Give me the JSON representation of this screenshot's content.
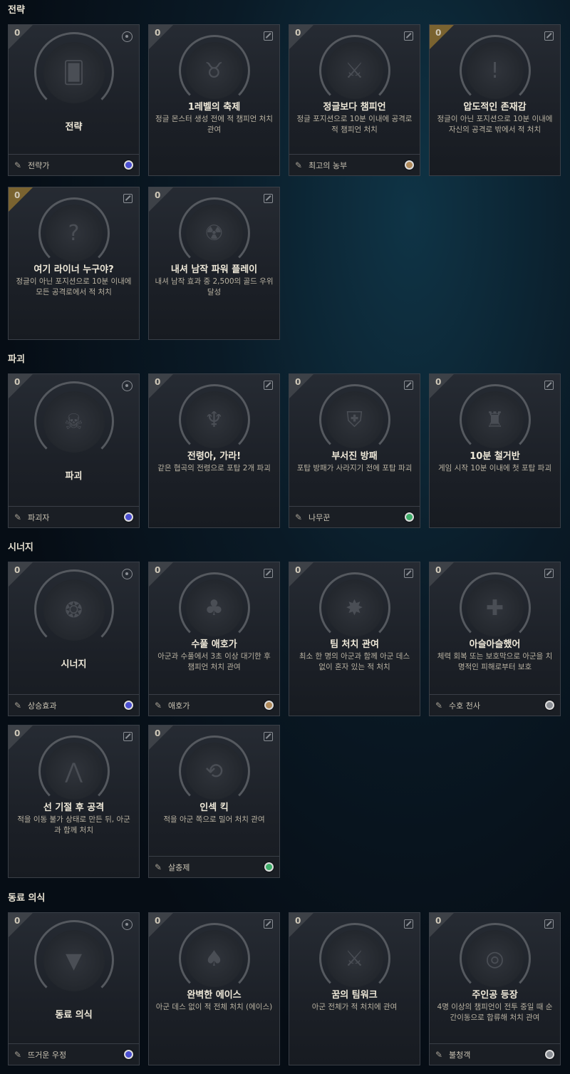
{
  "sections": [
    {
      "title": "전략"
    },
    {
      "title": "파괴"
    },
    {
      "title": "시너지"
    },
    {
      "title": "동료 의식"
    }
  ],
  "cards": [
    {
      "count": "0",
      "title": "전략",
      "desc": "",
      "footer": "전략가",
      "gem": "#4b4fd1",
      "icon": "cards-icon"
    },
    {
      "count": "0",
      "title": "1레벨의 축제",
      "desc": "정글 몬스터 생성 전에 적 챔피언 처치 관여",
      "footer": "",
      "icon": "ram-icon"
    },
    {
      "count": "0",
      "title": "정글보다 챔피언",
      "desc": "정글 포지션으로 10분 이내에 공격로 적 챔피언 처치",
      "footer": "최고의 농부",
      "gem": "#b08a5a",
      "icon": "beast-icon"
    },
    {
      "count": "0",
      "title": "압도적인 존재감",
      "desc": "정글이 아닌 포지션으로 10분 이내에 자신의 공격로 밖에서 적 처치",
      "footer": "",
      "icon": "exclamation-icon"
    },
    {
      "count": "0",
      "title": "여기 라이너 누구야?",
      "desc": "정글이 아닌 포지션으로 10분 이내에 모든 공격로에서 적 처치",
      "footer": "",
      "icon": "question-icon"
    },
    {
      "count": "0",
      "title": "내셔 남작 파워 플레이",
      "desc": "내셔 남작 효과 중 2,500의 골드 우위 달성",
      "footer": "",
      "icon": "baron-icon"
    },
    {
      "count": "0",
      "title": "파괴",
      "desc": "",
      "footer": "파괴자",
      "gem": "#4b4fd1",
      "icon": "skull-bomb-icon"
    },
    {
      "count": "0",
      "title": "전령아, 가라!",
      "desc": "같은 협곡의 전령으로 포탑 2개 파괴",
      "footer": "",
      "icon": "herald-icon"
    },
    {
      "count": "0",
      "title": "부서진 방패",
      "desc": "포탑 방패가 사라지기 전에 포탑 파괴",
      "footer": "나무꾼",
      "gem": "#3fae6a",
      "icon": "shield-icon"
    },
    {
      "count": "0",
      "title": "10분 철거반",
      "desc": "게임 시작 10분 이내에 첫 포탑 파괴",
      "footer": "",
      "icon": "tower-icon"
    },
    {
      "count": "0",
      "title": "시너지",
      "desc": "",
      "footer": "상승효과",
      "gem": "#4b4fd1",
      "icon": "swirl-icon"
    },
    {
      "count": "0",
      "title": "수풀 애호가",
      "desc": "아군과 수풀에서 3초 이상 대기한 후 챔피언 처치 관여",
      "footer": "애호가",
      "gem": "#b08a5a",
      "icon": "bush-icon"
    },
    {
      "count": "0",
      "title": "팀 처치 관여",
      "desc": "최소 한 명의 아군과 함께 아군 데스 없이 혼자 있는 적 처치",
      "footer": "",
      "icon": "burst-icon"
    },
    {
      "count": "0",
      "title": "아슬아슬했어",
      "desc": "체력 회복 또는 보호막으로 아군을 치명적인 피해로부터 보호",
      "footer": "수호 천사",
      "gem": "#8a8e94",
      "icon": "bandage-icon"
    },
    {
      "count": "0",
      "title": "선 기절 후 공격",
      "desc": "적을 이동 불가 상태로 만든 뒤, 아군과 함께 처치",
      "footer": "",
      "icon": "stun-icon"
    },
    {
      "count": "0",
      "title": "인섹 킥",
      "desc": "적을 아군 쪽으로 밀어 처치 관여",
      "footer": "살충제",
      "gem": "#3fae6a",
      "icon": "kick-icon"
    },
    {
      "count": "0",
      "title": "동료 의식",
      "desc": "",
      "footer": "뜨거운 우정",
      "gem": "#4b4fd1",
      "icon": "triangle-icon"
    },
    {
      "count": "0",
      "title": "완벽한 에이스",
      "desc": "아군 데스 없이 적 전체 처치 (에이스)",
      "footer": "",
      "icon": "spade-icon"
    },
    {
      "count": "0",
      "title": "꿈의 팀워크",
      "desc": "아군 전체가 적 처치에 관여",
      "footer": "",
      "icon": "swords-icon"
    },
    {
      "count": "0",
      "title": "주인공 등장",
      "desc": "4명 이상의 챔피언이 전투 중일 때 순간이동으로 합류해 처치 관여",
      "footer": "불청객",
      "gem": "#8a8e94",
      "icon": "teleport-icon"
    }
  ]
}
